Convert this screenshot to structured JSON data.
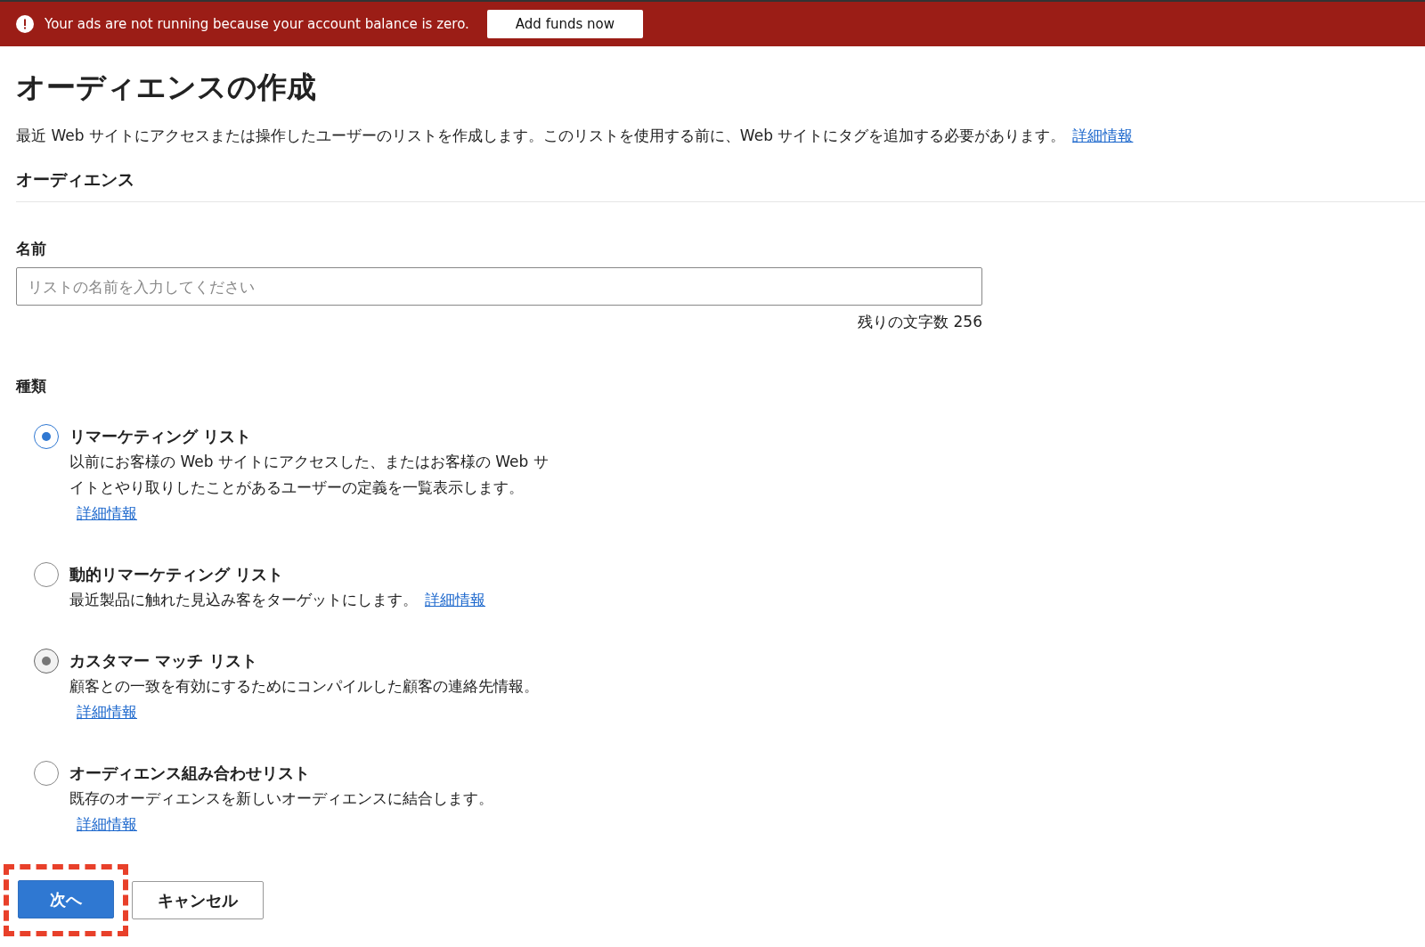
{
  "banner": {
    "message": "Your ads are not running because your account balance is zero.",
    "button": "Add funds now"
  },
  "title": "オーディエンスの作成",
  "description": {
    "text": "最近 Web サイトにアクセスまたは操作したユーザーのリストを作成します。このリストを使用する前に、Web サイトにタグを追加する必要があります。",
    "link": "詳細情報"
  },
  "section_title": "オーディエンス",
  "name_field": {
    "label": "名前",
    "placeholder": "リストの名前を入力してください",
    "counter": "残りの文字数 256"
  },
  "type_label": "種類",
  "options": [
    {
      "title": "リマーケティング リスト",
      "description": "以前にお客様の Web サイトにアクセスした、またはお客様の Web サイトとやり取りしたことがあるユーザーの定義を一覧表示します。",
      "link": "詳細情報",
      "selected": true,
      "disabled": false
    },
    {
      "title": "動的リマーケティング リスト",
      "description": "最近製品に触れた見込み客をターゲットにします。",
      "link": "詳細情報",
      "selected": false,
      "disabled": false
    },
    {
      "title": "カスタマー マッチ リスト",
      "description": "顧客との一致を有効にするためにコンパイルした顧客の連絡先情報。",
      "link": "詳細情報",
      "selected": true,
      "disabled": true
    },
    {
      "title": "オーディエンス組み合わせリスト",
      "description": "既存のオーディエンスを新しいオーディエンスに結合します。",
      "link": "詳細情報",
      "selected": false,
      "disabled": false
    }
  ],
  "buttons": [
    {
      "label": "次へ",
      "kind": "primary",
      "highlighted": true
    },
    {
      "label": "キャンセル",
      "kind": "secondary",
      "highlighted": false
    }
  ]
}
